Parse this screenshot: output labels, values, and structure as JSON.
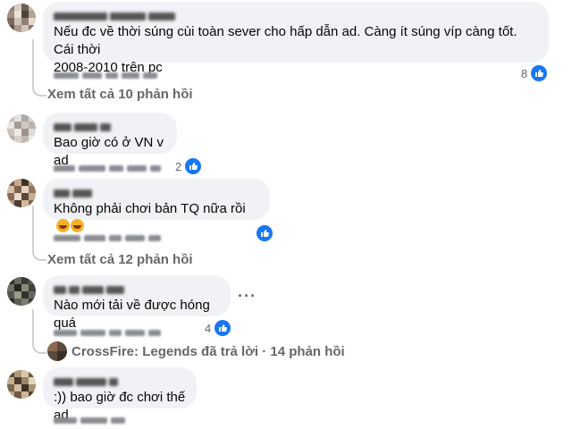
{
  "comments": [
    {
      "text": "Nếu đc về thời súng cùi toàn sever cho hấp dẫn ad. Càng ít súng víp càng tốt. Cái thời\n2008-2010 trên pc",
      "like_count": "8",
      "see_replies": "Xem tất cả 10 phản hồi"
    },
    {
      "text": "Bao giờ có ở VN v ad",
      "like_count": "2"
    },
    {
      "text": "Không phải chơi bản TQ nữa rồi",
      "emoji": [
        "rofl-emoji",
        "rofl-emoji"
      ],
      "like_count": "",
      "see_replies": "Xem tất cả 12 phản hồi"
    },
    {
      "text": "Nào mới tải về được hóng quá",
      "like_count": "4",
      "more_options": "···",
      "page_reply": "CrossFire: Legends đã trả lời · 14 phản hồi"
    },
    {
      "text": ":)) bao giờ đc chơi thế ad"
    }
  ],
  "colors": {
    "bubble": "#f0f2f5",
    "like_blue": "#1877f2",
    "secondary_text": "#65676b"
  }
}
